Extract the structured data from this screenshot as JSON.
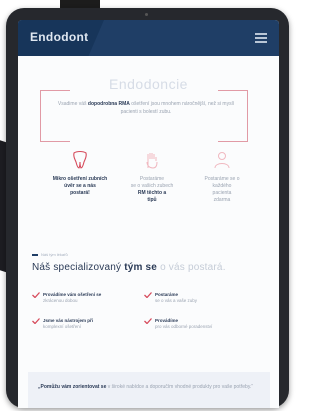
{
  "app": {
    "brand": "Endodont"
  },
  "page": {
    "title": "Endodoncie"
  },
  "intro": {
    "lead": "Vsadime váš",
    "bold_word": "dopodrobna RMA",
    "rest": "ošetření jsou mnohem náročnější, než si myslí pacienti s bolestí zubu."
  },
  "features": [
    {
      "title": "Mikro ošetření zubních",
      "line2": "úvěr se a nás",
      "line3": "postará!",
      "icon": "tooth-icon"
    },
    {
      "title": "Postaráme",
      "line2": "se o vašich zubech",
      "line3": "RM  těchto a",
      "line4": "tipů",
      "icon": "hand-icon"
    },
    {
      "title": "Postaráme se o",
      "line2": "každého",
      "line3": "pacienta",
      "line4": "zdarma",
      "icon": "person-icon"
    }
  ],
  "section": {
    "label": "Náš tým lékařů",
    "heading_main": "Náš specializovaný",
    "heading_bold": "tým se",
    "heading_light": "o vás postará."
  },
  "checks": [
    {
      "text_bold": "Provádíme vám ošetření se",
      "text_rest": "zkrácenou dobou"
    },
    {
      "text_bold": "Postaráme",
      "text_rest": "se o vás a vaše zuby"
    },
    {
      "text_bold": "Jsme vás nástrojem při",
      "text_rest": "komplexní ošetření"
    },
    {
      "text_bold": "Provádíme",
      "text_rest": "pro vás odborné poradenství"
    }
  ],
  "quote": {
    "bold": "„Pomůžu vám zorientovat se",
    "rest": "v široké nabídce a doporučím vhodné produkty pro vaše potřeby.“"
  },
  "colors": {
    "navy": "#1f3e66",
    "accent": "#d64b5c",
    "muted": "#9aa3b1"
  }
}
